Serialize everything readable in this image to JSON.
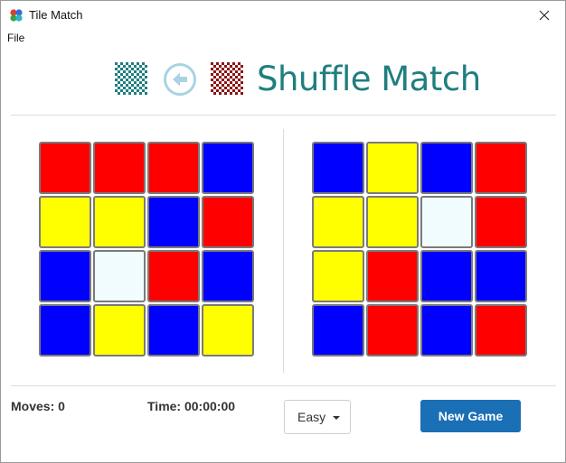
{
  "window": {
    "title": "Tile Match"
  },
  "menu": {
    "file_label": "File"
  },
  "header": {
    "title": "Shuffle Match"
  },
  "icons": {
    "app": "tile-match-app-icon",
    "close": "close-icon",
    "left_pattern": "checkerboard-teal-icon",
    "back": "back-arrow-icon",
    "right_pattern": "checkerboard-red-icon",
    "dropdown": "caret-down-icon"
  },
  "colors": {
    "red": "#ff0000",
    "blue": "#0000ff",
    "yellow": "#ffff00",
    "empty": "#f0fcfd",
    "teal": "#1f7e7f",
    "maroon": "#8b1414",
    "accent": "#1b6fb5"
  },
  "boards": {
    "player": [
      [
        "red",
        "red",
        "red",
        "blue"
      ],
      [
        "yellow",
        "yellow",
        "blue",
        "red"
      ],
      [
        "blue",
        "empty",
        "red",
        "blue"
      ],
      [
        "blue",
        "yellow",
        "blue",
        "yellow"
      ]
    ],
    "target": [
      [
        "blue",
        "yellow",
        "blue",
        "red"
      ],
      [
        "yellow",
        "yellow",
        "empty",
        "red"
      ],
      [
        "yellow",
        "red",
        "blue",
        "blue"
      ],
      [
        "blue",
        "red",
        "blue",
        "red"
      ]
    ]
  },
  "stats": {
    "moves": "Moves: 0",
    "time": "Time: 00:00:00"
  },
  "difficulty": {
    "selected": "Easy"
  },
  "actions": {
    "new_game_label": "New Game"
  }
}
